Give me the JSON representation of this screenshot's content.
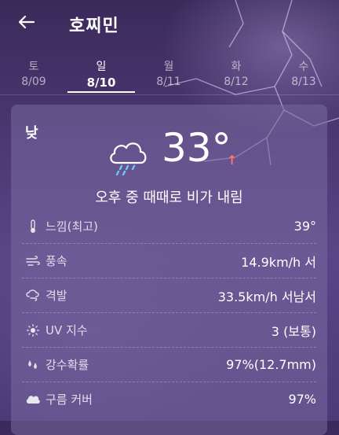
{
  "header": {
    "title": "호찌민"
  },
  "tabs": [
    {
      "dow": "토",
      "date": "8/09"
    },
    {
      "dow": "일",
      "date": "8/10"
    },
    {
      "dow": "월",
      "date": "8/11"
    },
    {
      "dow": "화",
      "date": "8/12"
    },
    {
      "dow": "수",
      "date": "8/13"
    }
  ],
  "card": {
    "period": "낮",
    "temperature": "33°",
    "trend_icon": "↑",
    "description": "오후 중 때때로 비가 내림",
    "icons": {
      "weather": "cloud-rain-icon",
      "trend": "arrow-up-icon"
    },
    "rows": [
      {
        "label": "느낌(최고)",
        "value": "39°",
        "icon": "thermometer-icon"
      },
      {
        "label": "풍속",
        "value": "14.9km/h 서",
        "icon": "wind-icon"
      },
      {
        "label": "격발",
        "value": "33.5km/h 서남서",
        "icon": "gust-icon"
      },
      {
        "label": "UV 지수",
        "value": "3 (보통)",
        "icon": "sun-icon"
      },
      {
        "label": "강수확률",
        "value": "97%(12.7mm)",
        "icon": "raindrops-icon"
      },
      {
        "label": "구름 커버",
        "value": "97%",
        "icon": "cloud-icon"
      }
    ]
  },
  "colors": {
    "accent_trend": "#ff7a5c",
    "rain_drops": "#6ec6ff"
  }
}
